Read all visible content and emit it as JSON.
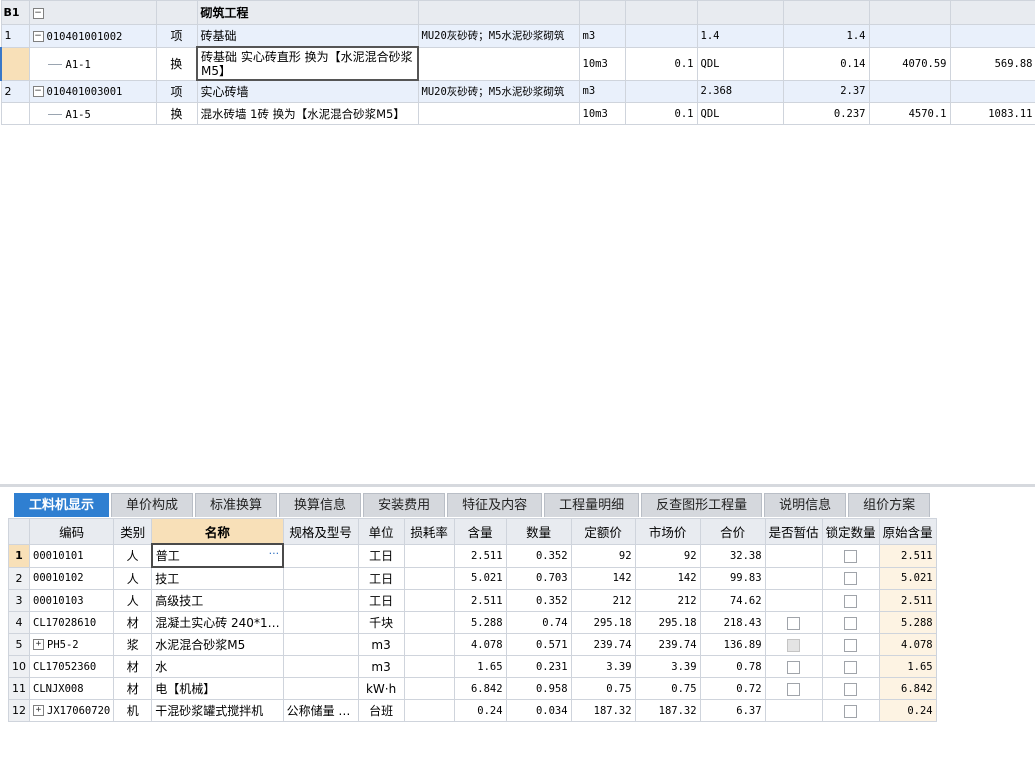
{
  "upper": {
    "section": {
      "id": "B1",
      "name": "砌筑工程"
    },
    "rows": [
      {
        "type": "main",
        "seq": "1",
        "code": "010401001002",
        "kind": "项",
        "name": "砖基础",
        "feature": "MU20灰砂砖；M5水泥砂浆砌筑",
        "unit": "m3",
        "ratio": "",
        "expr": "1.4",
        "qty": "1.4",
        "price": "",
        "total": ""
      },
      {
        "type": "sub",
        "seq": "",
        "code": "A1-1",
        "kind": "换",
        "name": "砖基础 实心砖直形  换为【水泥混合砂浆M5】",
        "feature": "",
        "unit": "10m3",
        "ratio": "0.1",
        "expr": "QDL",
        "qty": "0.14",
        "price": "4070.59",
        "total": "569.88"
      },
      {
        "type": "main",
        "seq": "2",
        "code": "010401003001",
        "kind": "项",
        "name": "实心砖墙",
        "feature": "MU20灰砂砖；M5水泥砂浆砌筑",
        "unit": "m3",
        "ratio": "",
        "expr": "2.368",
        "qty": "2.37",
        "price": "",
        "total": ""
      },
      {
        "type": "sub",
        "seq": "",
        "code": "A1-5",
        "kind": "换",
        "name": "混水砖墙 1砖  换为【水泥混合砂浆M5】",
        "feature": "",
        "unit": "10m3",
        "ratio": "0.1",
        "expr": "QDL",
        "qty": "0.237",
        "price": "4570.1",
        "total": "1083.11"
      }
    ]
  },
  "tabs": [
    "工料机显示",
    "单价构成",
    "标准换算",
    "换算信息",
    "安装费用",
    "特征及内容",
    "工程量明细",
    "反查图形工程量",
    "说明信息",
    "组价方案"
  ],
  "lower": {
    "headers": [
      "",
      "编码",
      "类别",
      "名称",
      "规格及型号",
      "单位",
      "损耗率",
      "含量",
      "数量",
      "定额价",
      "市场价",
      "合价",
      "是否暂估",
      "锁定数量",
      "原始含量"
    ],
    "rows": [
      {
        "no": "1",
        "code": "00010101",
        "cat": "人",
        "name": "普工",
        "spec": "",
        "unit": "工日",
        "loss": "",
        "content": "2.511",
        "qty": "0.352",
        "quota": "92",
        "market": "92",
        "sum": "32.38",
        "est": "",
        "lock": "box",
        "orig": "2.511"
      },
      {
        "no": "2",
        "code": "00010102",
        "cat": "人",
        "name": "技工",
        "spec": "",
        "unit": "工日",
        "loss": "",
        "content": "5.021",
        "qty": "0.703",
        "quota": "142",
        "market": "142",
        "sum": "99.83",
        "est": "",
        "lock": "box",
        "orig": "5.021"
      },
      {
        "no": "3",
        "code": "00010103",
        "cat": "人",
        "name": "高级技工",
        "spec": "",
        "unit": "工日",
        "loss": "",
        "content": "2.511",
        "qty": "0.352",
        "quota": "212",
        "market": "212",
        "sum": "74.62",
        "est": "",
        "lock": "box",
        "orig": "2.511"
      },
      {
        "no": "4",
        "code": "CL17028610",
        "cat": "材",
        "name": "混凝土实心砖 240*1…",
        "spec": "",
        "unit": "千块",
        "loss": "",
        "content": "5.288",
        "qty": "0.74",
        "quota": "295.18",
        "market": "295.18",
        "sum": "218.43",
        "est": "box",
        "lock": "box",
        "orig": "5.288"
      },
      {
        "no": "5",
        "code": "PH5-2",
        "cat": "浆",
        "name": "水泥混合砂浆M5",
        "spec": "",
        "unit": "m3",
        "loss": "",
        "content": "4.078",
        "qty": "0.571",
        "quota": "239.74",
        "market": "239.74",
        "sum": "136.89",
        "est": "dis",
        "lock": "box",
        "orig": "4.078"
      },
      {
        "no": "10",
        "code": "CL17052360",
        "cat": "材",
        "name": "水",
        "spec": "",
        "unit": "m3",
        "loss": "",
        "content": "1.65",
        "qty": "0.231",
        "quota": "3.39",
        "market": "3.39",
        "sum": "0.78",
        "est": "box",
        "lock": "box",
        "orig": "1.65"
      },
      {
        "no": "11",
        "code": "CLNJX008",
        "cat": "材",
        "name": "电【机械】",
        "spec": "",
        "unit": "kW·h",
        "loss": "",
        "content": "6.842",
        "qty": "0.958",
        "quota": "0.75",
        "market": "0.75",
        "sum": "0.72",
        "est": "box",
        "lock": "box",
        "orig": "6.842"
      },
      {
        "no": "12",
        "code": "JX17060720",
        "cat": "机",
        "name": "干混砂浆罐式搅拌机",
        "spec": "公称储量 …",
        "unit": "台班",
        "loss": "",
        "content": "0.24",
        "qty": "0.034",
        "quota": "187.32",
        "market": "187.32",
        "sum": "6.37",
        "est": "",
        "lock": "box",
        "orig": "0.24"
      }
    ]
  }
}
